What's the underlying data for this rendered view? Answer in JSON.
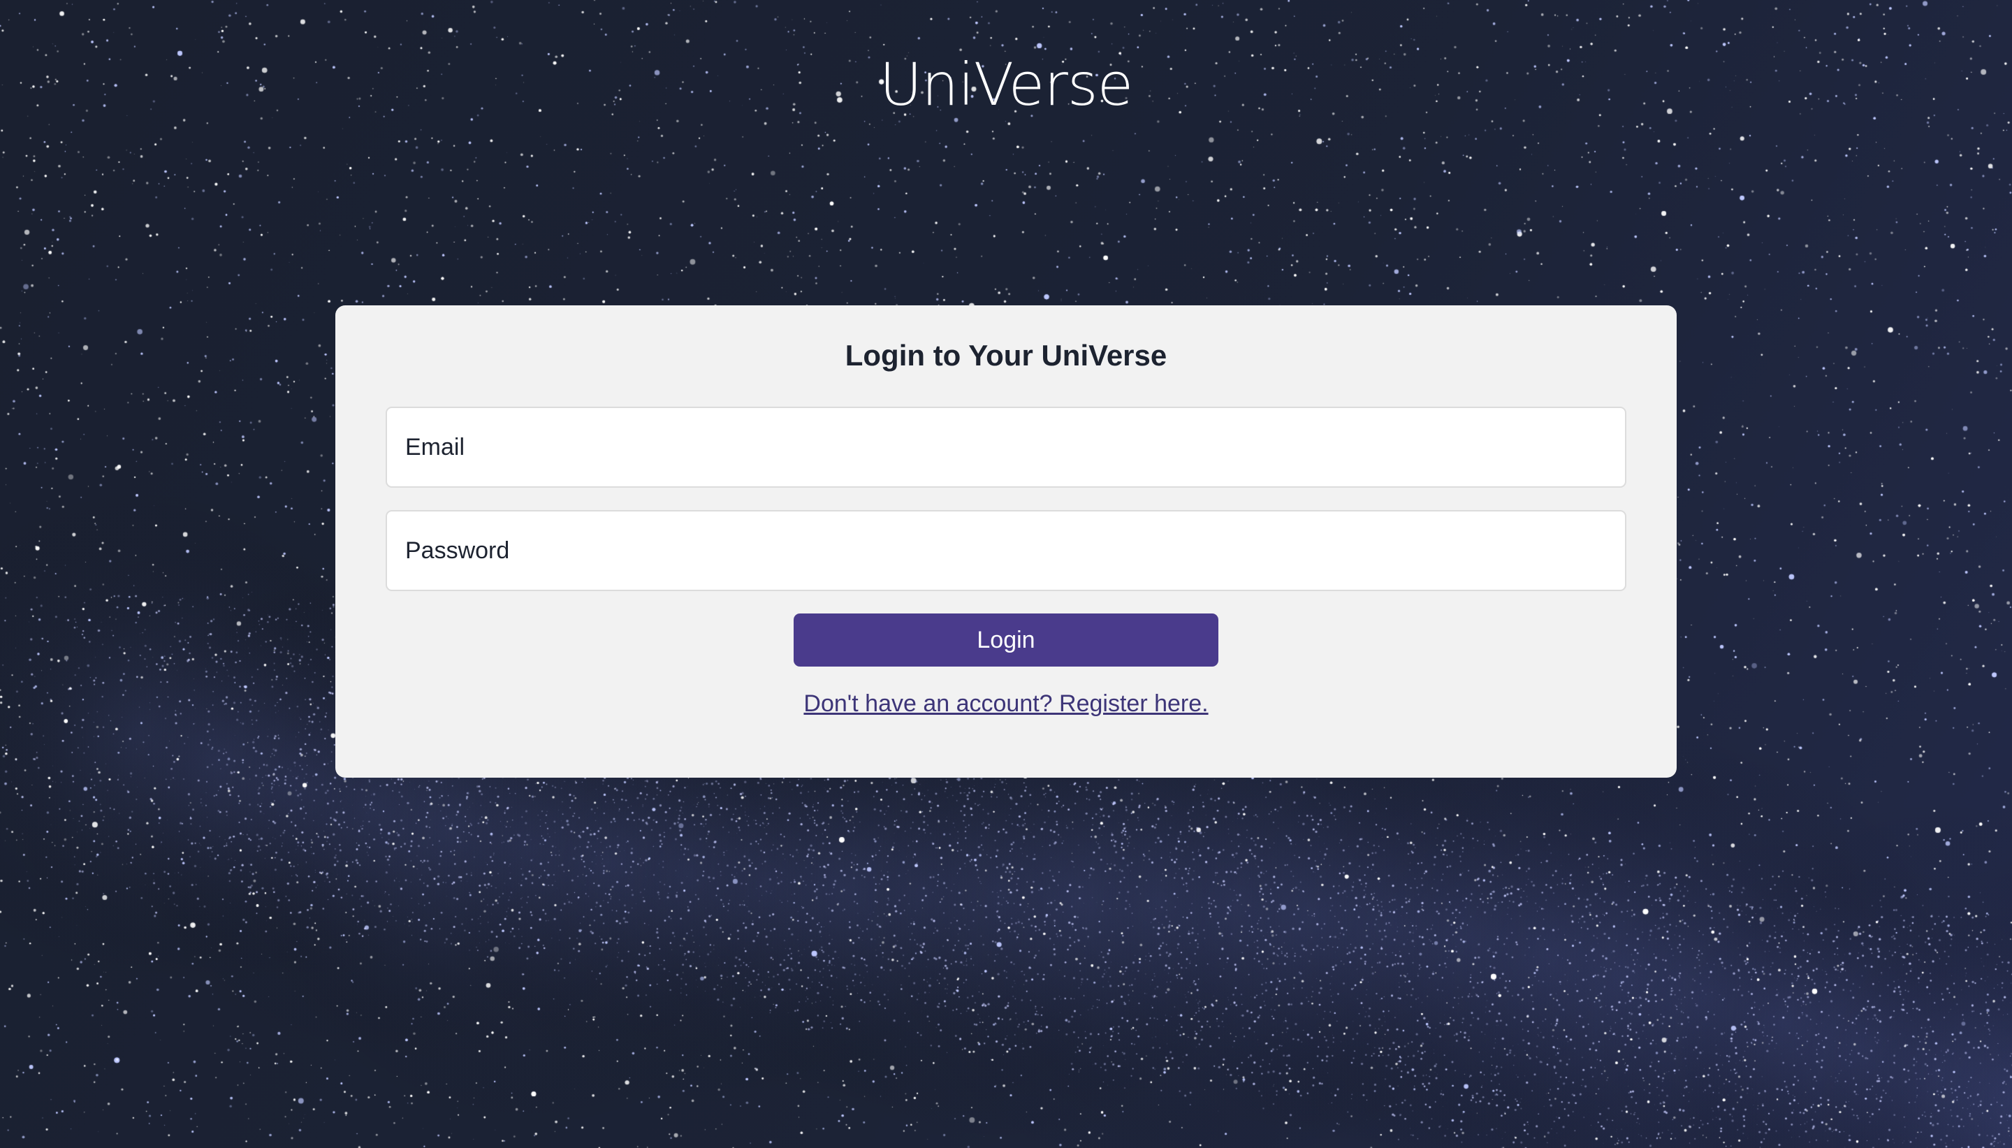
{
  "app": {
    "brand_title": "UniVerse"
  },
  "login_card": {
    "title": "Login to Your UniVerse",
    "email": {
      "placeholder": "Email",
      "value": ""
    },
    "password": {
      "placeholder": "Password",
      "value": ""
    },
    "login_button_label": "Login",
    "register_link_label": "Don't have an account? Register here."
  },
  "colors": {
    "background": "#1b2233",
    "card_background": "#f2f2f2",
    "accent_button": "#4a3b8c",
    "link": "#3d3578",
    "text_dark": "#1d2330"
  }
}
